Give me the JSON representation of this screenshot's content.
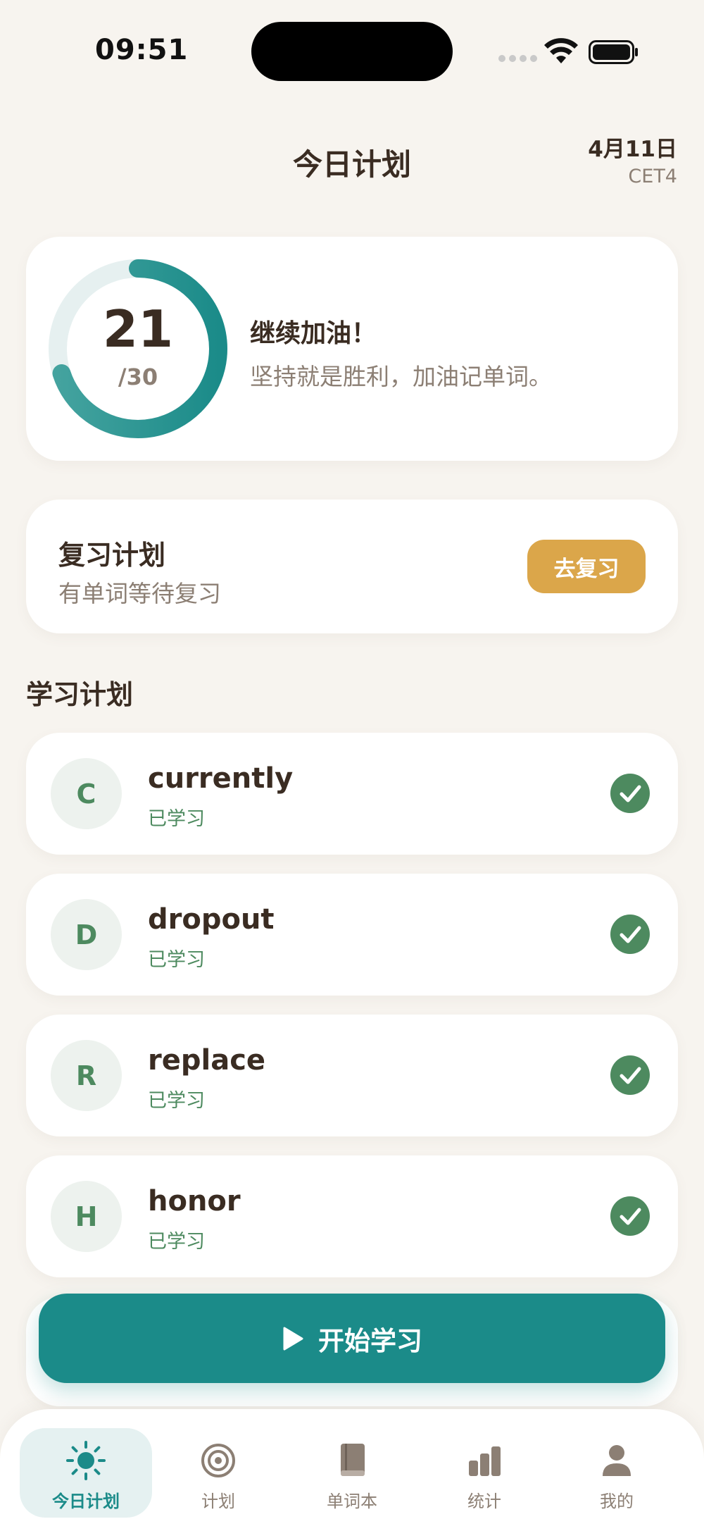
{
  "status_bar": {
    "time": "09:51"
  },
  "header": {
    "title": "今日计划",
    "date": "4月11日",
    "level": "CET4"
  },
  "progress": {
    "learned": 21,
    "learned_text": "21",
    "total_text": "/30",
    "fraction": 0.7,
    "title": "继续加油！",
    "subtitle": "坚持就是胜利，加油记单词。"
  },
  "review": {
    "title": "复习计划",
    "subtitle": "有单词等待复习",
    "button_label": "去复习"
  },
  "study": {
    "section_title": "学习计划",
    "words": [
      {
        "initial": "C",
        "word": "currently",
        "status": "已学习"
      },
      {
        "initial": "D",
        "word": "dropout",
        "status": "已学习"
      },
      {
        "initial": "R",
        "word": "replace",
        "status": "已学习"
      },
      {
        "initial": "H",
        "word": "honor",
        "status": "已学习"
      }
    ]
  },
  "start_button": {
    "label": "开始学习"
  },
  "tabs": [
    {
      "label": "今日计划",
      "icon": "sun-icon",
      "active": true
    },
    {
      "label": "计划",
      "icon": "target-icon",
      "active": false
    },
    {
      "label": "单词本",
      "icon": "book-icon",
      "active": false
    },
    {
      "label": "统计",
      "icon": "bar-chart-icon",
      "active": false
    },
    {
      "label": "我的",
      "icon": "person-icon",
      "active": false
    }
  ],
  "colors": {
    "accent": "#1b8b89",
    "review_button": "#dba64a",
    "check": "#4d8a5f",
    "background": "#f7f4ef"
  }
}
